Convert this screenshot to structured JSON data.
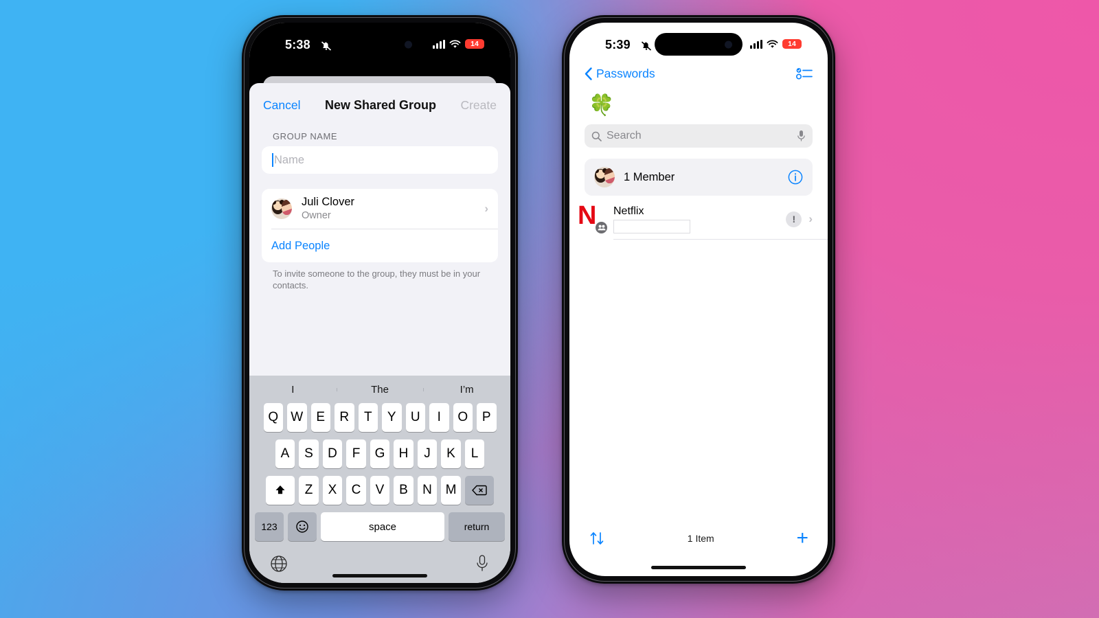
{
  "background": {
    "blue": "#3fb3f3",
    "pink": "#e95ca9",
    "mid": "#8190dc"
  },
  "accent": "#0a84ff",
  "phone_left": {
    "status": {
      "time": "5:38",
      "bell_icon": "bell-slash-icon",
      "signal_icon": "cellular-bars-icon",
      "wifi_icon": "wifi-icon",
      "battery": "14",
      "battery_color": "#ff3b30"
    },
    "sheet": {
      "cancel_label": "Cancel",
      "title": "New Shared Group",
      "create_label": "Create",
      "section_label": "GROUP NAME",
      "name_placeholder": "Name",
      "name_value": "",
      "person": {
        "name": "Juli Clover",
        "role": "Owner",
        "chevron_icon": "chevron-right-icon",
        "avatar_icon": "avatar"
      },
      "add_people_label": "Add People",
      "footnote": "To invite someone to the group, they must be in your contacts."
    },
    "keyboard": {
      "predictions": [
        "I",
        "The",
        "I’m"
      ],
      "row1": [
        "Q",
        "W",
        "E",
        "R",
        "T",
        "Y",
        "U",
        "I",
        "O",
        "P"
      ],
      "row2": [
        "A",
        "S",
        "D",
        "F",
        "G",
        "H",
        "J",
        "K",
        "L"
      ],
      "row3": [
        "Z",
        "X",
        "C",
        "V",
        "B",
        "N",
        "M"
      ],
      "shift_icon": "shift-up-icon",
      "backspace_icon": "backspace-icon",
      "numbers_label": "123",
      "emoji_icon": "emoji-smiley-icon",
      "space_label": "space",
      "return_label": "return",
      "globe_icon": "globe-icon",
      "dictation_icon": "microphone-icon"
    }
  },
  "phone_right": {
    "status": {
      "time": "5:39",
      "bell_icon": "bell-slash-icon",
      "signal_icon": "cellular-bars-icon",
      "wifi_icon": "wifi-icon",
      "battery": "14",
      "battery_color": "#ff3b30"
    },
    "nav": {
      "back_icon": "chevron-left-icon",
      "back_label": "Passwords",
      "select_icon": "select-list-icon"
    },
    "group_emoji": "🍀",
    "search": {
      "icon": "search-icon",
      "placeholder": "Search",
      "value": "",
      "mic_icon": "microphone-icon"
    },
    "member_row": {
      "label": "1 Member",
      "info_icon": "info-circle-icon",
      "avatar_icon": "avatar"
    },
    "items": [
      {
        "title": "Netflix",
        "username": "",
        "logo_icon": "netflix-logo-icon",
        "shared_icon": "shared-people-badge-icon",
        "warning_icon": "exclamation-badge-icon",
        "chevron_icon": "chevron-right-icon"
      }
    ],
    "bottom": {
      "sort_icon": "sort-arrows-icon",
      "count_label": "1 Item",
      "add_icon": "plus-icon"
    }
  }
}
